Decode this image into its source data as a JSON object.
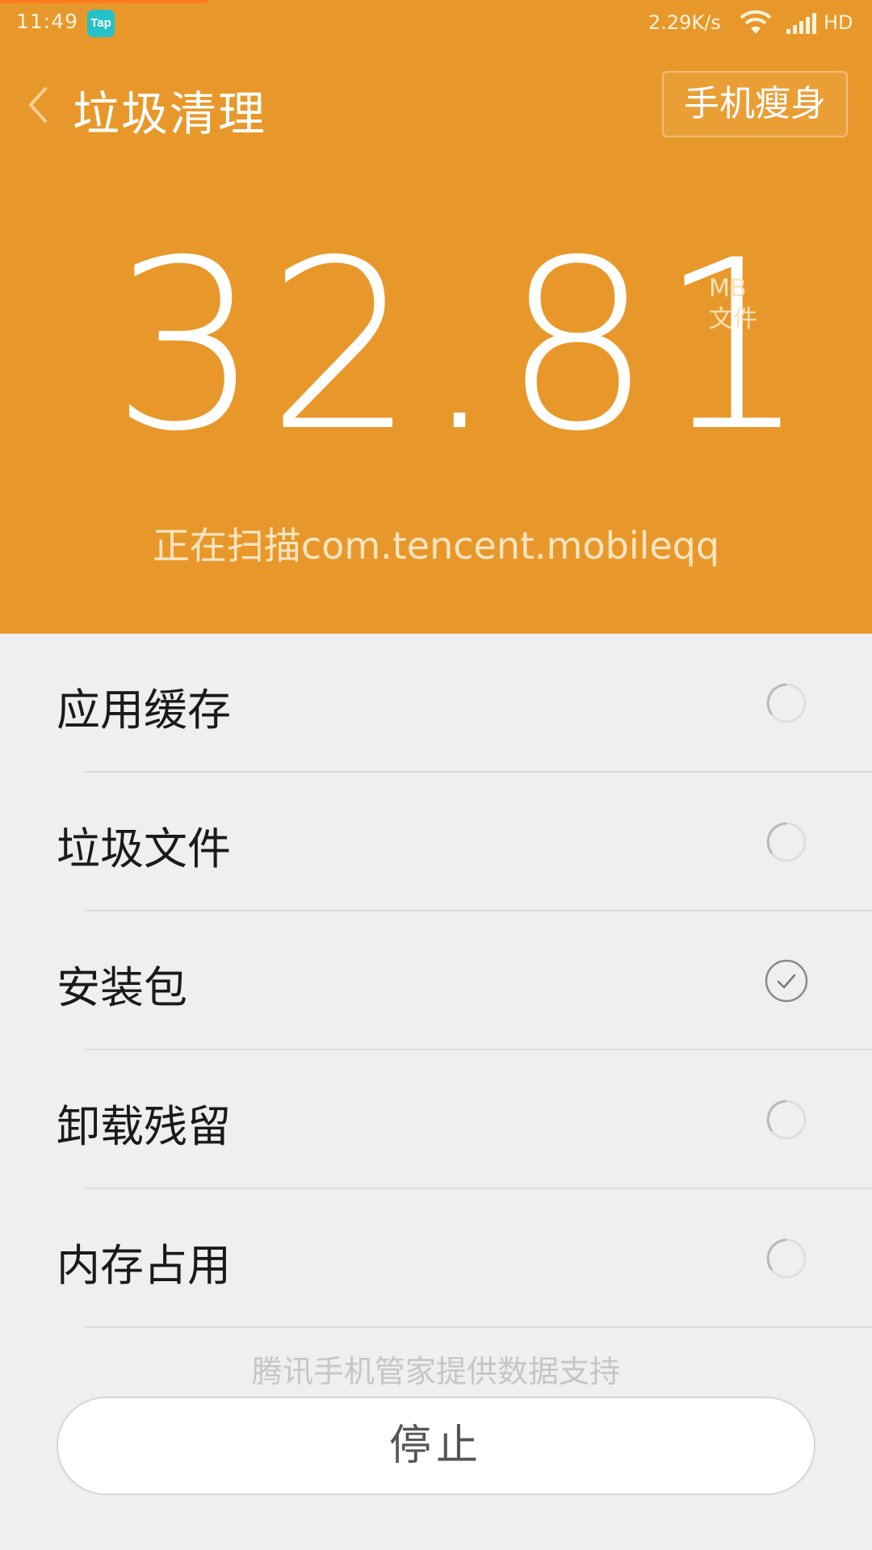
{
  "status_bar": {
    "time": "11:49",
    "app_badge": "Tap",
    "net_speed": "2.29K/s",
    "hd_label": "HD"
  },
  "header": {
    "title": "垃圾清理",
    "slim_button_label": "手机瘦身",
    "back_icon": "chevron-left-icon"
  },
  "summary": {
    "size_value": "32.81",
    "unit": "MB",
    "kind": "文件",
    "scan_status": "正在扫描com.tencent.mobileqq"
  },
  "categories": [
    {
      "label": "应用缓存",
      "state": "scanning"
    },
    {
      "label": "垃圾文件",
      "state": "scanning"
    },
    {
      "label": "安装包",
      "state": "done"
    },
    {
      "label": "卸载残留",
      "state": "scanning"
    },
    {
      "label": "内存占用",
      "state": "scanning"
    }
  ],
  "footer": {
    "provider_note": "腾讯手机管家提供数据支持",
    "stop_label": "停止"
  },
  "colors": {
    "accent": "#e8982a",
    "background": "#efefef"
  }
}
